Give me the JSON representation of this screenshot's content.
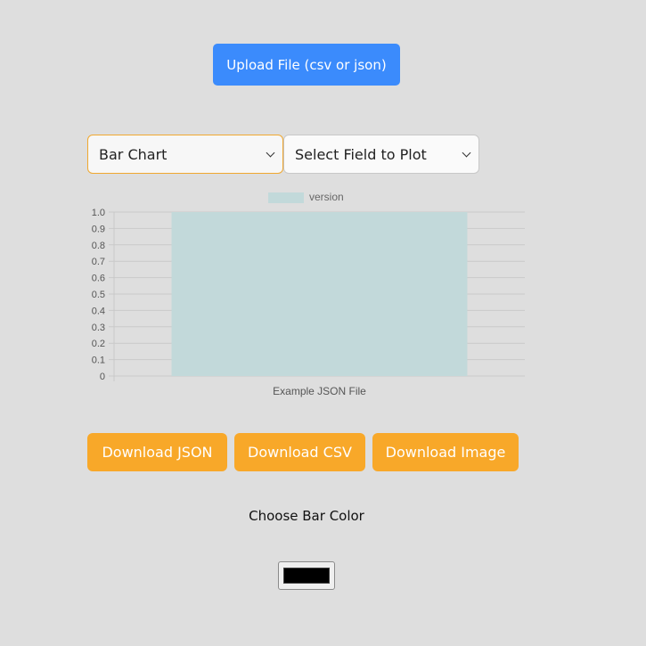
{
  "upload": {
    "label": "Upload File (csv or json)"
  },
  "controls": {
    "chart_type": {
      "selected": "Bar Chart"
    },
    "field": {
      "selected": "Select Field to Plot"
    }
  },
  "chart_data": {
    "type": "bar",
    "categories": [
      "Example JSON File"
    ],
    "series": [
      {
        "name": "version",
        "values": [
          1.0
        ],
        "color": "#c2d9da"
      }
    ],
    "ylim": [
      0,
      1.0
    ],
    "yticks": [
      "1.0",
      "0.9",
      "0.8",
      "0.7",
      "0.6",
      "0.5",
      "0.4",
      "0.3",
      "0.2",
      "0.1",
      "0"
    ],
    "grid": true,
    "legend": "top-center"
  },
  "downloads": {
    "json_label": "Download JSON",
    "csv_label": "Download CSV",
    "image_label": "Download Image"
  },
  "color": {
    "label": "Choose Bar Color",
    "value": "#000000"
  }
}
